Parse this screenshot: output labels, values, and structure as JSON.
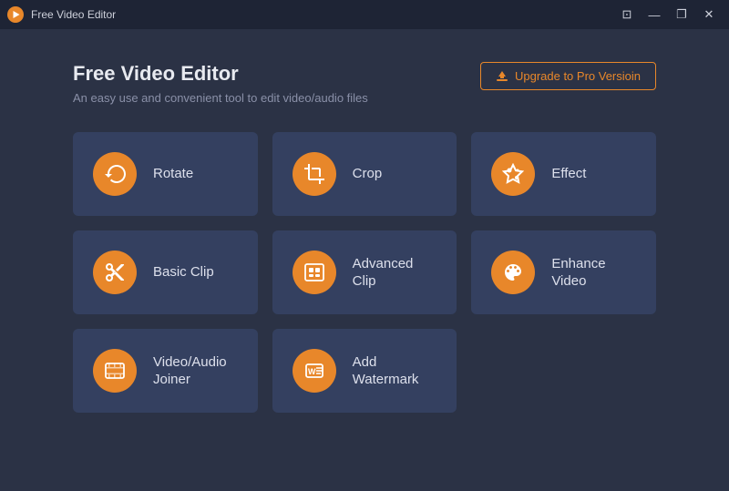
{
  "titlebar": {
    "title": "Free Video Editor",
    "controls": {
      "minimize": "—",
      "maximize": "❐",
      "close": "✕",
      "restore": "⊡"
    }
  },
  "header": {
    "title": "Free Video Editor",
    "subtitle": "An easy use and convenient tool to edit video/audio files",
    "upgrade_btn": "Upgrade to Pro Versioin"
  },
  "tools": [
    {
      "id": "rotate",
      "label": "Rotate",
      "icon": "↻"
    },
    {
      "id": "crop",
      "label": "Crop",
      "icon": "⊡"
    },
    {
      "id": "effect",
      "label": "Effect",
      "icon": "★"
    },
    {
      "id": "basic-clip",
      "label": "Basic Clip",
      "icon": "✂"
    },
    {
      "id": "advanced-clip",
      "label": "Advanced Clip",
      "icon": "▦"
    },
    {
      "id": "enhance-video",
      "label": "Enhance\nVideo",
      "icon": "◉"
    },
    {
      "id": "video-audio-joiner",
      "label": "Video/Audio\nJoiner",
      "icon": "▣"
    },
    {
      "id": "add-watermark",
      "label": "Add\nWatermark",
      "icon": "⊕"
    }
  ]
}
